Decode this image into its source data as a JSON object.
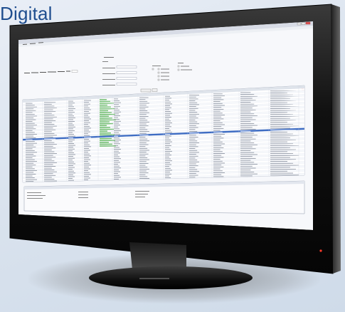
{
  "brand": {
    "text": "Digital"
  },
  "app": {
    "crumb": "",
    "filter_label": "",
    "menu": [
      "",
      "",
      ""
    ],
    "title": ""
  },
  "colors": {
    "brand_text": "#1f4e8f",
    "selection": "#3d6cc3",
    "status_bar_green": "#6cbc6a"
  }
}
